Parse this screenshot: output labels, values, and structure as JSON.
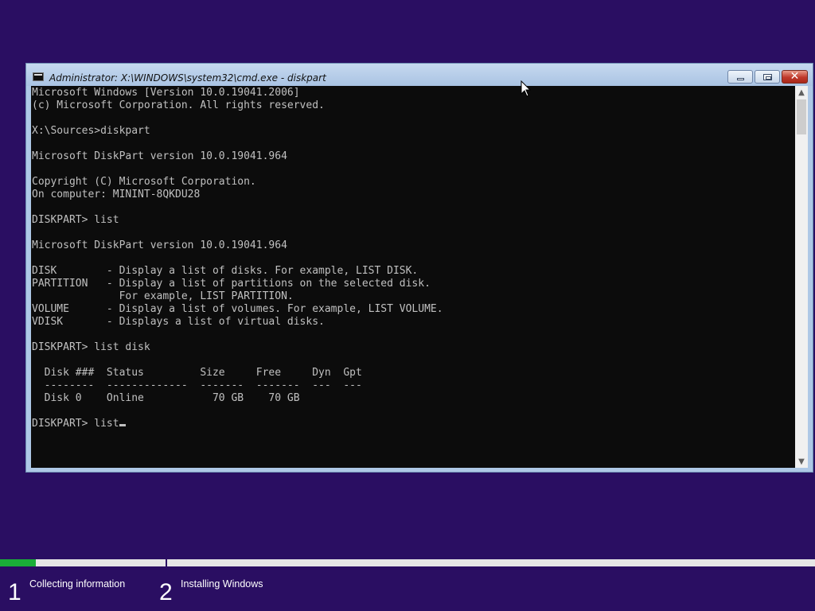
{
  "window": {
    "title": "Administrator: X:\\WINDOWS\\system32\\cmd.exe - diskpart",
    "controls": {
      "minimize": "minimize-icon",
      "maximize": "maximize-icon",
      "close": "close-icon"
    }
  },
  "console": {
    "lines": [
      "Microsoft Windows [Version 10.0.19041.2006]",
      "(c) Microsoft Corporation. All rights reserved.",
      "",
      "X:\\Sources>diskpart",
      "",
      "Microsoft DiskPart version 10.0.19041.964",
      "",
      "Copyright (C) Microsoft Corporation.",
      "On computer: MININT-8QKDU28",
      "",
      "DISKPART> list",
      "",
      "Microsoft DiskPart version 10.0.19041.964",
      "",
      "DISK        - Display a list of disks. For example, LIST DISK.",
      "PARTITION   - Display a list of partitions on the selected disk.",
      "              For example, LIST PARTITION.",
      "VOLUME      - Display a list of volumes. For example, LIST VOLUME.",
      "VDISK       - Displays a list of virtual disks.",
      "",
      "DISKPART> list disk",
      "",
      "  Disk ###  Status         Size     Free     Dyn  Gpt",
      "  --------  -------------  -------  -------  ---  ---",
      "  Disk 0    Online           70 GB    70 GB",
      "",
      "DISKPART> list"
    ],
    "colors": {
      "background": "#0c0c0c",
      "text": "#c0c0c0"
    }
  },
  "setup": {
    "progress_fraction": 0.044,
    "steps": [
      {
        "number": "1",
        "label": "Collecting information"
      },
      {
        "number": "2",
        "label": "Installing Windows"
      }
    ],
    "colors": {
      "background": "#2a0e62",
      "progress": "#1aae38",
      "track": "#e6e6e6"
    }
  }
}
